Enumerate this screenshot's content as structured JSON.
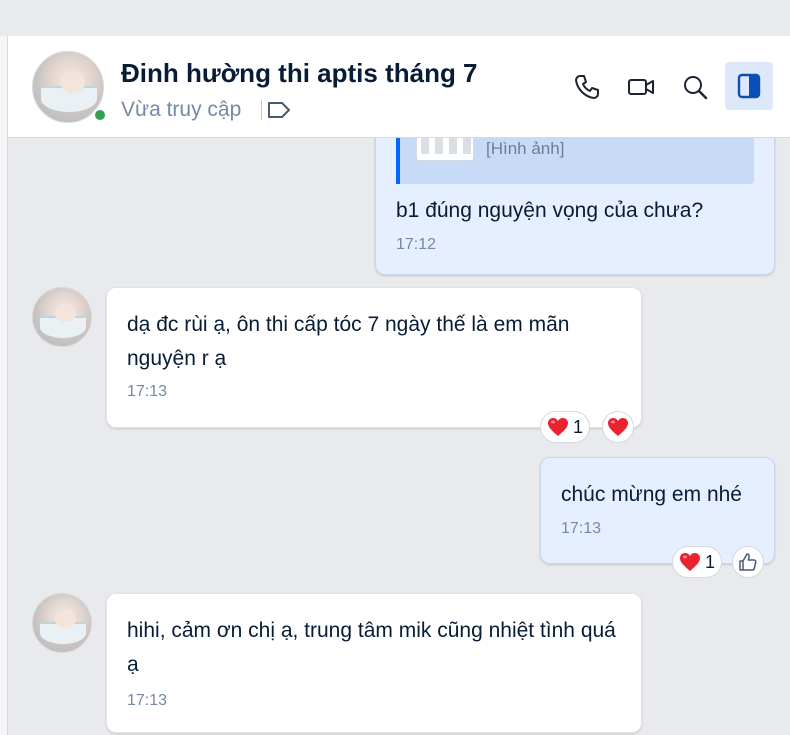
{
  "header": {
    "contact_name": "Đinh hường thi aptis tháng 7",
    "status": "Vừa truy cập",
    "icons": [
      "phone-icon",
      "video-call-icon",
      "search-icon",
      "side-panel-icon",
      "tag-icon"
    ]
  },
  "messages": [
    {
      "sender": "me",
      "quote_label": "[Hình ảnh]",
      "text": "b1 đúng nguyện vọng của chưa?",
      "time": "17:12"
    },
    {
      "sender": "them",
      "text": "dạ đc rùi ạ, ôn thi cấp tóc 7 ngày thế là em mãn nguyện r ạ",
      "time": "17:13",
      "reactions": [
        {
          "icon": "heart-icon",
          "count": "1"
        }
      ]
    },
    {
      "sender": "me",
      "text": "chúc mừng em nhé",
      "time": "17:13",
      "reactions": [
        {
          "icon": "heart-icon",
          "count": "1"
        }
      ]
    },
    {
      "sender": "them",
      "text": "hihi, cảm ơn chị ạ, trung tâm mik cũng nhiệt tình quá ạ",
      "time": "17:13"
    }
  ],
  "colors": {
    "accent": "#0068ff",
    "my_bubble": "#e5efff",
    "their_bubble": "#ffffff",
    "online": "#30a24c",
    "heart": "#e8232f"
  }
}
